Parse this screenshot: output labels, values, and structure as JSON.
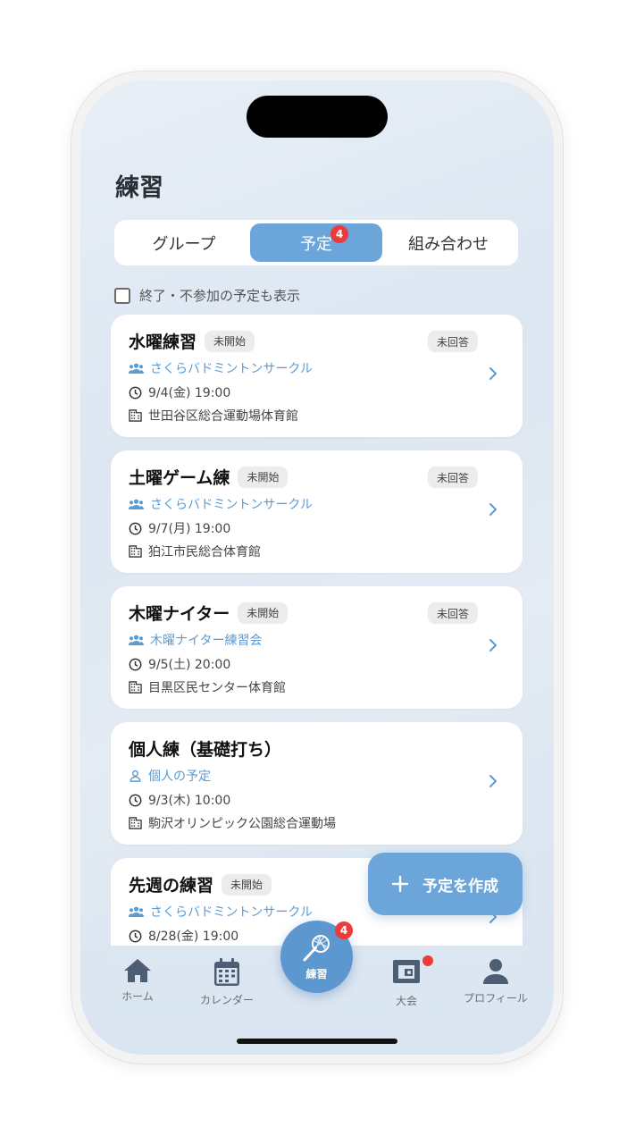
{
  "page": {
    "title": "練習"
  },
  "segments": {
    "tabs": [
      {
        "label": "グループ"
      },
      {
        "label": "予定",
        "badge": "4"
      },
      {
        "label": "組み合わせ"
      }
    ]
  },
  "filter": {
    "label": "終了・不参加の予定も表示"
  },
  "cards": [
    {
      "title": "水曜練習",
      "status": "未開始",
      "response": "未回答",
      "group": "さくらバドミントンサークル",
      "time": "9/4(金) 19:00",
      "venue": "世田谷区総合運動場体育館",
      "group_icon": "group-icon"
    },
    {
      "title": "土曜ゲーム練",
      "status": "未開始",
      "response": "未回答",
      "group": "さくらバドミントンサークル",
      "time": "9/7(月) 19:00",
      "venue": "狛江市民総合体育館",
      "group_icon": "group-icon"
    },
    {
      "title": "木曜ナイター",
      "status": "未開始",
      "response": "未回答",
      "group": "木曜ナイター練習会",
      "time": "9/5(土) 20:00",
      "venue": "目黒区民センター体育館",
      "group_icon": "group-icon"
    },
    {
      "title": "個人練（基礎打ち）",
      "status": "",
      "response": "",
      "group": "個人の予定",
      "time": "9/3(木) 10:00",
      "venue": "駒沢オリンピック公園総合運動場",
      "group_icon": "person-icon"
    },
    {
      "title": "先週の練習",
      "status": "未開始",
      "response": "",
      "group": "さくらバドミントンサークル",
      "time": "8/28(金) 19:00",
      "venue": "",
      "group_icon": "group-icon"
    }
  ],
  "fab": {
    "label": "予定を作成",
    "icon": "plus-icon"
  },
  "bottom_nav": {
    "home": "ホーム",
    "calendar": "カレンダー",
    "practice": "練習",
    "practice_badge": "4",
    "tournament": "大会",
    "profile": "プロフィール"
  },
  "colors": {
    "accent": "#6ca5d9",
    "badge": "#ec3b3b",
    "group_text": "#5b9bd3"
  }
}
